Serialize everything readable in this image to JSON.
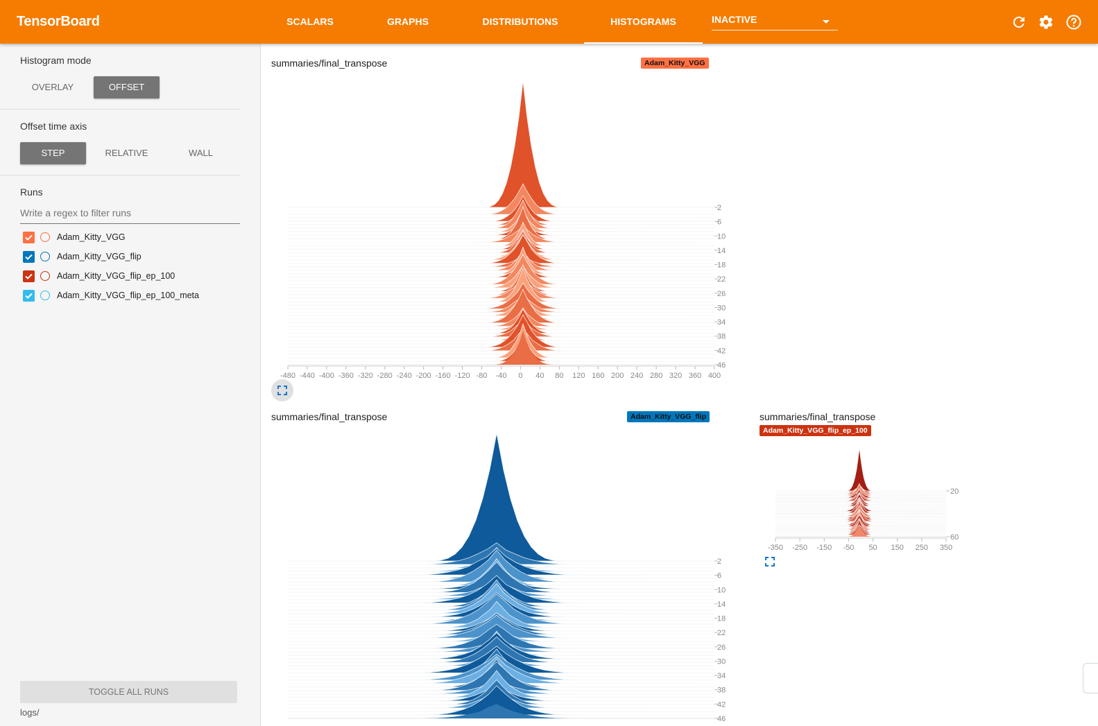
{
  "app": {
    "title": "TensorBoard",
    "accent": "#f57c00",
    "tabs": [
      {
        "label": "SCALARS"
      },
      {
        "label": "GRAPHS"
      },
      {
        "label": "DISTRIBUTIONS"
      },
      {
        "label": "HISTOGRAMS",
        "active": true
      }
    ],
    "inactive_select": "INACTIVE",
    "icons": [
      "refresh-icon",
      "settings-icon",
      "help-icon"
    ]
  },
  "sidebar": {
    "histogram_mode": {
      "title": "Histogram mode",
      "options": [
        "OVERLAY",
        "OFFSET"
      ],
      "selected": "OFFSET"
    },
    "offset_time_axis": {
      "title": "Offset time axis",
      "options": [
        "STEP",
        "RELATIVE",
        "WALL"
      ],
      "selected": "STEP"
    },
    "runs": {
      "title": "Runs",
      "filter_placeholder": "Write a regex to filter runs",
      "items": [
        {
          "label": "Adam_Kitty_VGG",
          "color": "#ff7043",
          "checked": true
        },
        {
          "label": "Adam_Kitty_VGG_flip",
          "color": "#0077bb",
          "checked": true
        },
        {
          "label": "Adam_Kitty_VGG_flip_ep_100",
          "color": "#cc3311",
          "checked": true
        },
        {
          "label": "Adam_Kitty_VGG_flip_ep_100_meta",
          "color": "#33bbee",
          "checked": true
        }
      ],
      "toggle_all": "TOGGLE ALL RUNS",
      "logdir": "logs/"
    }
  },
  "cards": [
    {
      "title": "summaries/final_transpose",
      "run": "Adam_Kitty_VGG",
      "tag_color": "#ff7043",
      "x_ticks": [
        "-480",
        "-440",
        "-400",
        "-360",
        "-320",
        "-280",
        "-240",
        "-200",
        "-160",
        "-120",
        "-80",
        "-40",
        "0",
        "40",
        "80",
        "120",
        "160",
        "200",
        "240",
        "280",
        "320",
        "360",
        "400"
      ],
      "y_ticks": [
        "2",
        "6",
        "10",
        "14",
        "18",
        "22",
        "26",
        "30",
        "34",
        "38",
        "42",
        "46"
      ]
    },
    {
      "title": "summaries/final_transpose",
      "run": "Adam_Kitty_VGG_flip",
      "tag_color": "#0077bb",
      "y_ticks": [
        "2",
        "6",
        "10",
        "14",
        "18",
        "22",
        "26",
        "30",
        "34",
        "38",
        "42",
        "46"
      ]
    },
    {
      "title": "summaries/final_transpose",
      "run": "Adam_Kitty_VGG_flip_ep_100",
      "tag_color": "#cc3311",
      "x_ticks": [
        "-350",
        "-250",
        "-150",
        "-50",
        "50",
        "150",
        "250",
        "350"
      ],
      "y_ticks": [
        "20",
        "60"
      ]
    }
  ],
  "chart_data": [
    {
      "type": "area",
      "title": "summaries/final_transpose",
      "series": [
        {
          "name": "Adam_Kitty_VGG",
          "color": "#ff7043"
        }
      ],
      "mode": "offset",
      "x_range": [
        -480,
        400
      ],
      "step_range": [
        2,
        46
      ],
      "peak_center": 0
    },
    {
      "type": "area",
      "title": "summaries/final_transpose",
      "series": [
        {
          "name": "Adam_Kitty_VGG_flip",
          "color": "#0077bb"
        }
      ],
      "mode": "offset",
      "step_range": [
        2,
        46
      ]
    },
    {
      "type": "area",
      "title": "summaries/final_transpose",
      "series": [
        {
          "name": "Adam_Kitty_VGG_flip_ep_100",
          "color": "#cc3311"
        }
      ],
      "mode": "offset",
      "x_range": [
        -350,
        350
      ],
      "step_range": [
        20,
        60
      ]
    }
  ]
}
